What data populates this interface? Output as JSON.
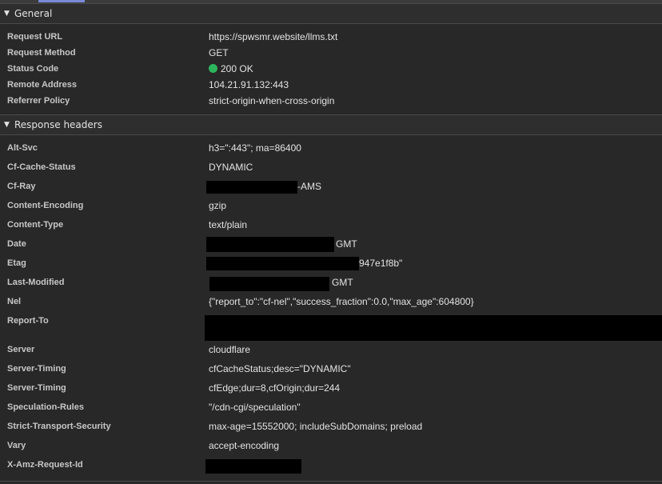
{
  "general": {
    "title": "General",
    "rows": [
      {
        "key": "Request URL",
        "value": "https://spwsmr.website/llms.txt"
      },
      {
        "key": "Request Method",
        "value": "GET"
      },
      {
        "key": "Status Code",
        "value": "200 OK"
      },
      {
        "key": "Remote Address",
        "value": "104.21.91.132:443"
      },
      {
        "key": "Referrer Policy",
        "value": "strict-origin-when-cross-origin"
      }
    ],
    "status_color": "#2db55d"
  },
  "response": {
    "title": "Response headers",
    "rows": [
      {
        "key": "Alt-Svc",
        "value": "h3=\":443\"; ma=86400"
      },
      {
        "key": "Cf-Cache-Status",
        "value": "DYNAMIC"
      },
      {
        "key": "Cf-Ray",
        "value": "-AMS"
      },
      {
        "key": "Content-Encoding",
        "value": "gzip"
      },
      {
        "key": "Content-Type",
        "value": "text/plain"
      },
      {
        "key": "Date",
        "value": "GMT"
      },
      {
        "key": "Etag",
        "value": "947e1f8b\""
      },
      {
        "key": "Last-Modified",
        "value": "GMT"
      },
      {
        "key": "Nel",
        "value": "{\"report_to\":\"cf-nel\",\"success_fraction\":0.0,\"max_age\":604800}"
      },
      {
        "key": "Report-To",
        "value": ""
      },
      {
        "key": "Server",
        "value": "cloudflare"
      },
      {
        "key": "Server-Timing",
        "value": "cfCacheStatus;desc=\"DYNAMIC\""
      },
      {
        "key": "Server-Timing",
        "value": "cfEdge;dur=8,cfOrigin;dur=244"
      },
      {
        "key": "Speculation-Rules",
        "value": "\"/cdn-cgi/speculation\""
      },
      {
        "key": "Strict-Transport-Security",
        "value": "max-age=15552000; includeSubDomains; preload"
      },
      {
        "key": "Vary",
        "value": "accept-encoding"
      },
      {
        "key": "X-Amz-Request-Id",
        "value": ""
      }
    ]
  },
  "icons": {
    "collapse": "triangle-down-icon",
    "status": "green-dot-icon"
  }
}
